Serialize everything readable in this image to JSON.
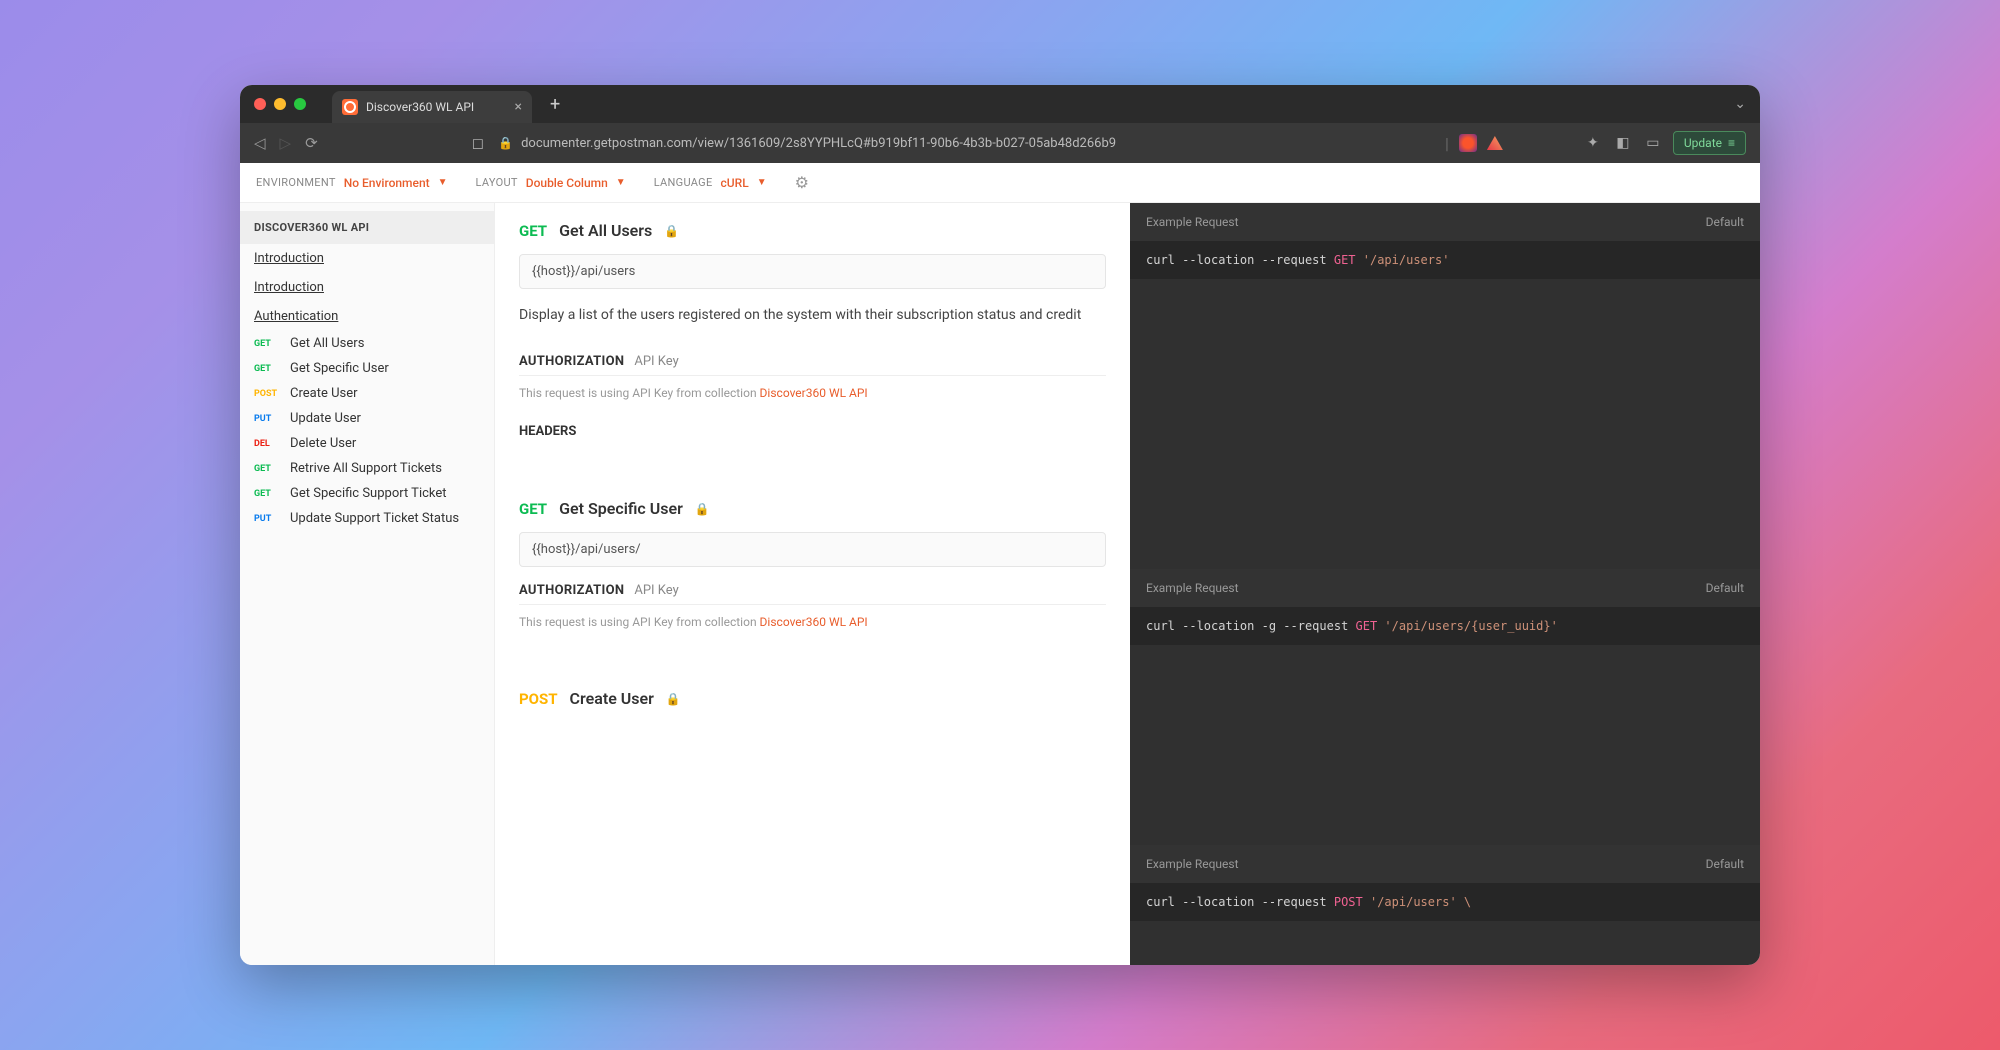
{
  "browser": {
    "tab_title": "Discover360 WL API",
    "url": "documenter.getpostman.com/view/1361609/2s8YYPHLcQ#b919bf11-90b6-4b3b-b027-05ab48d266b9",
    "update_label": "Update"
  },
  "toolbar": {
    "env_label": "ENVIRONMENT",
    "env_value": "No Environment",
    "layout_label": "LAYOUT",
    "layout_value": "Double Column",
    "lang_label": "LANGUAGE",
    "lang_value": "cURL"
  },
  "sidebar": {
    "header": "DISCOVER360 WL API",
    "links": [
      "Introduction",
      "Introduction",
      "Authentication"
    ],
    "items": [
      {
        "method": "GET",
        "cls": "m-get",
        "label": "Get All Users"
      },
      {
        "method": "GET",
        "cls": "m-get",
        "label": "Get Specific User"
      },
      {
        "method": "POST",
        "cls": "m-post",
        "label": "Create User"
      },
      {
        "method": "PUT",
        "cls": "m-put",
        "label": "Update User"
      },
      {
        "method": "DEL",
        "cls": "m-del",
        "label": "Delete User"
      },
      {
        "method": "GET",
        "cls": "m-get",
        "label": "Retrive All Support Tickets"
      },
      {
        "method": "GET",
        "cls": "m-get",
        "label": "Get Specific Support Ticket"
      },
      {
        "method": "PUT",
        "cls": "m-put",
        "label": "Update Support Ticket Status"
      }
    ]
  },
  "endpoints": [
    {
      "method": "GET",
      "method_cls": "m-get",
      "name": "Get All Users",
      "url": "{{host}}/api/users",
      "desc": "Display a list of the users registered on the system with their subscription status and credit",
      "auth_title": "AUTHORIZATION",
      "auth_sub": "API Key",
      "auth_text": "This request is using API Key from collection ",
      "auth_link": "Discover360 WL API",
      "headers_title": "HEADERS"
    },
    {
      "method": "GET",
      "method_cls": "m-get",
      "name": "Get Specific User",
      "url": "{{host}}/api/users/",
      "desc": "",
      "auth_title": "AUTHORIZATION",
      "auth_sub": "API Key",
      "auth_text": "This request is using API Key from collection ",
      "auth_link": "Discover360 WL API",
      "headers_title": ""
    },
    {
      "method": "POST",
      "method_cls": "m-post",
      "name": "Create User",
      "url": "",
      "desc": "",
      "auth_title": "",
      "auth_sub": "",
      "auth_text": "",
      "auth_link": "",
      "headers_title": ""
    }
  ],
  "examples": {
    "request_label": "Example Request",
    "default_label": "Default",
    "blocks": [
      {
        "prefix": "curl --location --request ",
        "method": "GET",
        "url": " '/api/users'"
      },
      {
        "prefix": "curl --location -g --request ",
        "method": "GET",
        "url": " '/api/users/{user_uuid}'"
      },
      {
        "prefix": "curl --location --request ",
        "method": "POST",
        "url": " '/api/users' \\"
      }
    ]
  }
}
